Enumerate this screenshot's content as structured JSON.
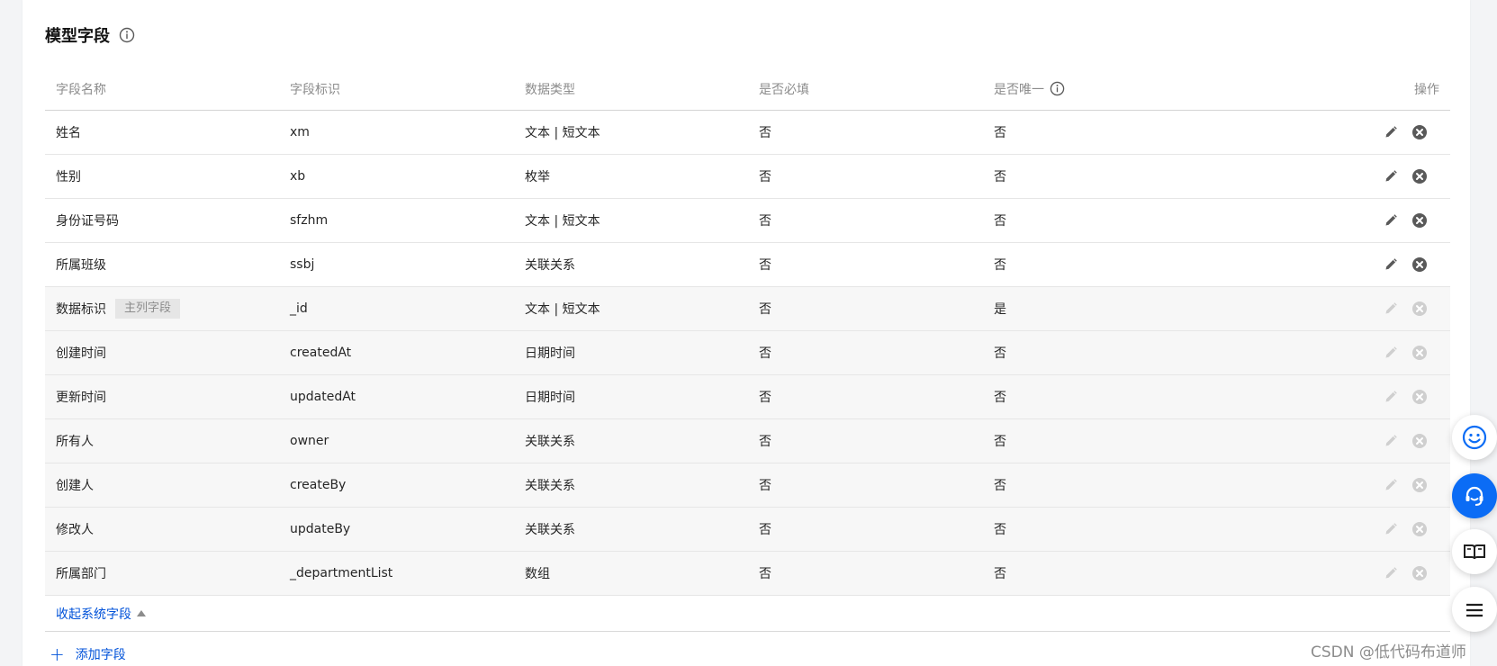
{
  "section": {
    "title": "模型字段"
  },
  "columns": {
    "name": "字段名称",
    "key": "字段标识",
    "type": "数据类型",
    "required": "是否必填",
    "unique": "是否唯一",
    "actions": "操作"
  },
  "rows": [
    {
      "name": "姓名",
      "key": "xm",
      "type": "文本 | 短文本",
      "required": "否",
      "unique": "否"
    },
    {
      "name": "性别",
      "key": "xb",
      "type": "枚举",
      "required": "否",
      "unique": "否"
    },
    {
      "name": "身份证号码",
      "key": "sfzhm",
      "type": "文本 | 短文本",
      "required": "否",
      "unique": "否"
    },
    {
      "name": "所属班级",
      "key": "ssbj",
      "type": "关联关系",
      "required": "否",
      "unique": "否"
    },
    {
      "name": "数据标识",
      "tag": "主列字段",
      "key": "_id",
      "type": "文本 | 短文本",
      "required": "否",
      "unique": "是"
    },
    {
      "name": "创建时间",
      "key": "createdAt",
      "type": "日期时间",
      "required": "否",
      "unique": "否"
    },
    {
      "name": "更新时间",
      "key": "updatedAt",
      "type": "日期时间",
      "required": "否",
      "unique": "否"
    },
    {
      "name": "所有人",
      "key": "owner",
      "type": "关联关系",
      "required": "否",
      "unique": "否"
    },
    {
      "name": "创建人",
      "key": "createBy",
      "type": "关联关系",
      "required": "否",
      "unique": "否"
    },
    {
      "name": "修改人",
      "key": "updateBy",
      "type": "关联关系",
      "required": "否",
      "unique": "否"
    },
    {
      "name": "所属部门",
      "key": "_departmentList",
      "type": "数组",
      "required": "否",
      "unique": "否"
    }
  ],
  "footer": {
    "collapse_label": "收起系统字段",
    "add_label": "添加字段"
  },
  "watermark": "CSDN @低代码布道师",
  "icons": {
    "edit": "pencil-icon",
    "delete": "close-circle-icon",
    "info": "info-circle-icon"
  },
  "colors": {
    "primary": "#0052d9",
    "float_primary": "#0b6cf5",
    "action_active": "#595959",
    "action_disabled": "#cfcfcf",
    "system_row_bg": "#f7f7f7"
  }
}
